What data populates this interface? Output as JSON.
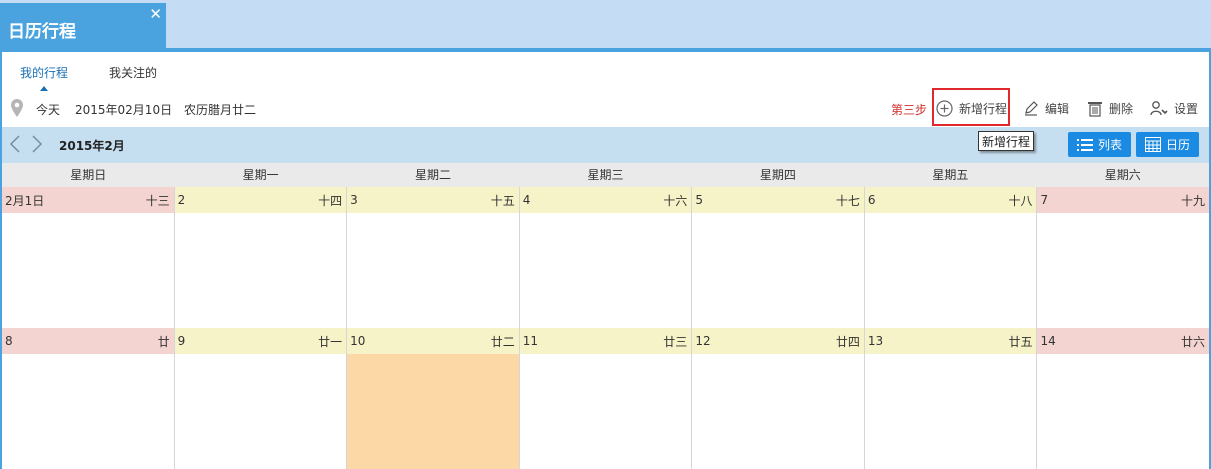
{
  "window_tab": {
    "title": "日历行程",
    "close": "✕"
  },
  "subtabs": {
    "mine": "我的行程",
    "follow": "我关注的"
  },
  "info": {
    "today_label": "今天",
    "date": "2015年02月10日",
    "lunar": "农历腊月廿二"
  },
  "step_label": "第三步",
  "toolbar": {
    "add": "新增行程",
    "edit": "编辑",
    "delete": "删除",
    "settings": "设置"
  },
  "tooltip": "新增行程",
  "month_nav": {
    "label": "2015年2月",
    "list_btn": "列表",
    "calendar_btn": "日历"
  },
  "weekdays": [
    "星期日",
    "星期一",
    "星期二",
    "星期三",
    "星期四",
    "星期五",
    "星期六"
  ],
  "weeks": [
    [
      {
        "day": "2月1日",
        "lunar": "十三"
      },
      {
        "day": "2",
        "lunar": "十四"
      },
      {
        "day": "3",
        "lunar": "十五"
      },
      {
        "day": "4",
        "lunar": "十六"
      },
      {
        "day": "5",
        "lunar": "十七"
      },
      {
        "day": "6",
        "lunar": "十八"
      },
      {
        "day": "7",
        "lunar": "十九"
      }
    ],
    [
      {
        "day": "8",
        "lunar": "廿"
      },
      {
        "day": "9",
        "lunar": "廿一"
      },
      {
        "day": "10",
        "lunar": "廿二",
        "today": true
      },
      {
        "day": "11",
        "lunar": "廿三"
      },
      {
        "day": "12",
        "lunar": "廿四"
      },
      {
        "day": "13",
        "lunar": "廿五"
      },
      {
        "day": "14",
        "lunar": "廿六"
      }
    ]
  ],
  "colors": {
    "accent": "#4aa3df",
    "button": "#1a8ae2",
    "weekend": "#f3d4d0",
    "weekday": "#f7f3c9",
    "today": "#fbd8a6",
    "step": "#d0302c"
  }
}
